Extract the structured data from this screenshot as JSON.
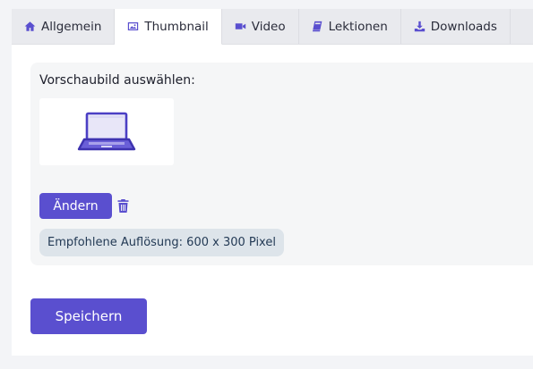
{
  "tabs": [
    {
      "label": "Allgemein",
      "icon": "home-icon",
      "active": false
    },
    {
      "label": "Thumbnail",
      "icon": "image-icon",
      "active": true
    },
    {
      "label": "Video",
      "icon": "video-camera-icon",
      "active": false
    },
    {
      "label": "Lektionen",
      "icon": "book-icon",
      "active": false
    },
    {
      "label": "Downloads",
      "icon": "download-icon",
      "active": false
    }
  ],
  "thumbnail": {
    "label": "Vorschaubild auswählen:",
    "change_label": "Ändern",
    "hint": "Empfohlene Auflösung: 600 x 300 Pixel"
  },
  "save_label": "Speichern",
  "colors": {
    "accent": "#5a4fcf",
    "hint_bg": "#dde4ea",
    "hint_text": "#233a55"
  }
}
